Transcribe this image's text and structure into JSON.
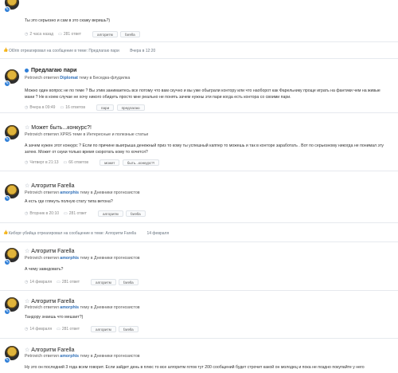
{
  "feed": {
    "card1": {
      "body": "Ты это серьезно и сам в это скажу веришь?)",
      "time": "2 часа назад",
      "replies": "281 ответ",
      "tags": [
        "алгоритм",
        "farella"
      ]
    },
    "react1": {
      "text": "Ol0rin отреагировал на сообщение в теме: Предлагаю пари",
      "time": "Вчера в 12:20"
    },
    "card2": {
      "title": "Предлагаю пари",
      "meta_prefix": "Petrovich ответил ",
      "meta_user": "Diplomat",
      "meta_suffix": " тему в Беседка-флудилка",
      "body": "Можно один вопрос не по теме ? Вы этим занимаетесь все потому что вам скучно и вы уже обыграли контору или что наоборот как Фарельнику проще играть на фантики чем на живые мани ? Не в коем случае не хочу никого обидеть просто мне реально не понять зачем нужны эти пари когда есть контора со своими пари.",
      "time": "Вчера в 09:49",
      "replies": "16 ответов",
      "tags": [
        "пари",
        "предлагаю"
      ]
    },
    "card3": {
      "title": "Может быть...конкурс?!",
      "meta": "Petrovich ответил XPRS теме в Интересные и полезные статьи",
      "body": "А зачем нужен этот конкурс ? Если по причине выигрыша денежный приз то кому ты успешный каппер то можешь и так в конторе заработать . Вот по серьезному никогда не понимал эту затею. Может от скуки только время скоротать кому то хочется?",
      "time": "Четверг в 21:13",
      "replies": "66 ответов",
      "tags": [
        "может",
        "быть...конкурс?!"
      ]
    },
    "card4": {
      "title": "Алгоритм Farella",
      "meta_prefix": "Petrovich ответил ",
      "meta_user": "amorphis",
      "meta_suffix": " тему в Дневники прогнозистов",
      "body": "А есть где глянуть полную стату типа ветона?",
      "time": "Вторник в 20:10",
      "replies": "281 ответ",
      "tags": [
        "алгоритм",
        "farella"
      ]
    },
    "react2": {
      "text": "Киборг-убийца отреагировал на сообщение в теме: Алгоритм Farella",
      "time": "14 февраля"
    },
    "card5": {
      "title": "Алгоритм Farella",
      "meta_prefix": "Petrovich ответил ",
      "meta_user": "amorphis",
      "meta_suffix": " тему в Дневники прогнозистов",
      "body": "А чему завидовать?",
      "time": "14 февраля",
      "replies": "281 ответ",
      "tags": [
        "алгоритм",
        "farella"
      ]
    },
    "card6": {
      "title": "Алгоритм Farella",
      "meta_prefix": "Petrovich ответил ",
      "meta_user": "amorphis",
      "meta_suffix": " тему в Дневники прогнозистов",
      "body": "Тандору знаешь что мешает?)",
      "time": "14 февраля",
      "replies": "281 ответ",
      "tags": [
        "алгоритм",
        "farella"
      ]
    },
    "card7": {
      "title": "Алгоритм Farella",
      "meta_prefix": "Petrovich ответил ",
      "meta_user": "amorphis",
      "meta_suffix": " тему в Дневники прогнозистов",
      "body": "Ну это он последний 3 года всем говорит. Если зайдет день в плюс то все алгоритм готов тут 200 сообщений будет строчит какой он молодец и пока не поздно покупайте у него"
    }
  }
}
